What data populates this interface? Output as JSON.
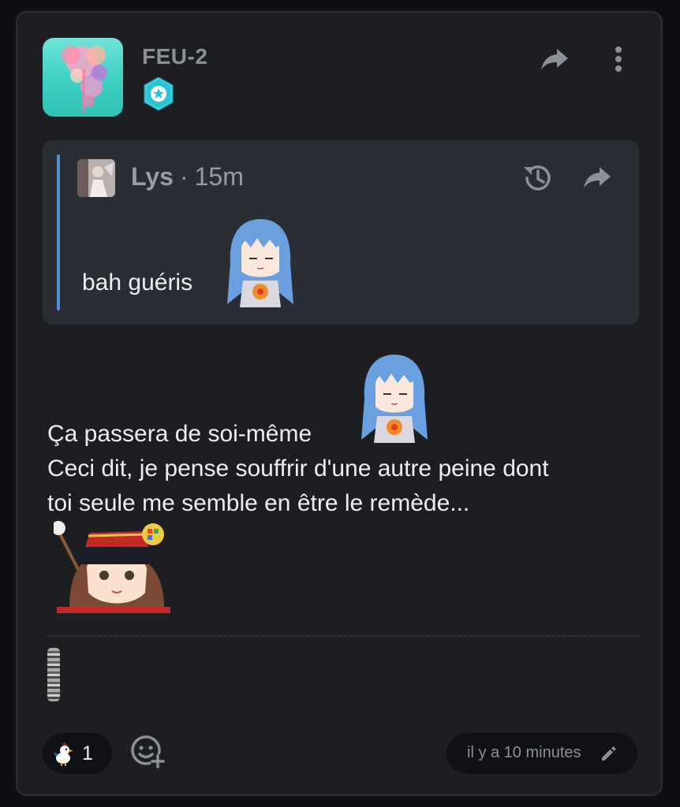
{
  "post": {
    "author": "FEU-2",
    "icons": {
      "avatar": "flower-splash-avatar",
      "badge": "star-hexagon-badge",
      "share": "share-arrow-icon",
      "more": "more-vertical-icon"
    },
    "colors": {
      "card_bg": "#1d1e22",
      "quote_bg": "#2a2d34",
      "quote_accent": "#4e8fd6",
      "badge": "#29c3d6"
    }
  },
  "quote": {
    "author": "Lys",
    "separator": "·",
    "time": "15m",
    "text": "bah guéris",
    "icons": {
      "history": "history-icon",
      "share": "share-arrow-icon",
      "sticker": "anime-girl-blue-hair-sticker"
    }
  },
  "body": {
    "lines": [
      "Ça passera de soi-même",
      "Ceci dit, je pense souffrir d'une autre peine dont",
      "toi seule me semble en être le remède..."
    ],
    "stickers": [
      "anime-girl-blue-hair-sticker",
      "anime-officer-girl-sticker"
    ]
  },
  "footer": {
    "reaction": {
      "icon": "rooster-emoji",
      "count": "1"
    },
    "add_reaction_icon": "add-reaction-icon",
    "timestamp": "il y a 10 minutes",
    "edit_icon": "pencil-icon"
  }
}
